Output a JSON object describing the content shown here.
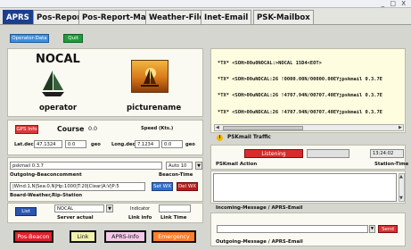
{
  "window": {
    "controls": "_ □ X"
  },
  "tabs": [
    {
      "label": "APRS",
      "active": true
    },
    {
      "label": "Pos-Report",
      "active": false
    },
    {
      "label": "Pos-Report-Map",
      "active": false
    },
    {
      "label": "Weather-Files",
      "active": false
    },
    {
      "label": "Inet-Email",
      "active": false
    },
    {
      "label": "PSK-Mailbox",
      "active": false
    }
  ],
  "toolbar": {
    "operator_data": "Operator-Data",
    "quit": "Quit"
  },
  "station": {
    "callsign": "NOCAL",
    "operator_label": "operator",
    "picture_label": "picturename"
  },
  "gps": {
    "info_button": "GPS Info",
    "course_label": "Course",
    "course_value": "0.0",
    "speed_label": "Speed (Kts.)",
    "lat_label": "Lat.deci",
    "lat_value": "47.1324",
    "lat_field2": "0.0",
    "lat_unit": "geo",
    "lon_label": "Long.deci",
    "lon_value": "7.1234",
    "lon_field2": "0.0",
    "lon_unit": "geo"
  },
  "beacon": {
    "message": "pskmail 0.3.7",
    "interval": "Auto 10",
    "outgoing_label": "Outgoing-Beaconcomment",
    "beacon_time_label": "Beacon-Time",
    "weather_string": "|Wind:1,N|Sea:0,N|Hp:1000|T:20|Clear|A:V|P:5",
    "set_wx": "Set WX",
    "del_wx": "Del WX",
    "board_label": "Board-Weather,Rip-Station"
  },
  "server": {
    "list_button": "List",
    "server_value": "NOCAL",
    "indicator_label": "Indicator",
    "server_actual_label": "Server actual",
    "link_info_label": "Link info",
    "link_time_label": "Link Time"
  },
  "bottom_buttons": {
    "pos_beacon": "Pos-Beacon",
    "link": "Link",
    "aprs_info": "APRS-Info",
    "emergency": "Emergency"
  },
  "traffic": {
    "lines": [
      "*TX*  <SOH>00u0NOCAL:>NOCAL 15D4<EOT>",
      "*TX*  <SOH>00uNOCAL:26 !0000.00N/00000.00EYjpskmail 0.3.7E",
      "*TX*  <SOH>00uNOCAL:26 !4707.94N/00707.40EYjpskmail 0.3.7E",
      "*TX*  <SOH>00uNOCAL:26 !4707.94N/00707.40EYjpskmail 0.3.7E"
    ],
    "label": "PSKmail Traffic"
  },
  "status": {
    "listening": "Listening",
    "time": "13:24:02",
    "action_label": "PSKmail Action",
    "station_time_label": "Station-Time"
  },
  "email": {
    "incoming_label": "Incoming-Message / APRS-Email",
    "outgoing_label": "Outgoing-Message / APRS-Email",
    "send_button": "Send"
  },
  "colors": {
    "tab_active": "#1b3f8f",
    "operator_button": "#3d8fe0",
    "quit_button": "#1f9a3c",
    "gps_button": "#d83a3a",
    "set_wx": "#2f6fcf",
    "del_wx": "#b81c1c",
    "list_button": "#2a55b0",
    "pos_beacon": "#e21f2b",
    "emergency": "#ff7e2a",
    "listening": "#d82c2c",
    "traffic_bg": "#fffde0"
  }
}
